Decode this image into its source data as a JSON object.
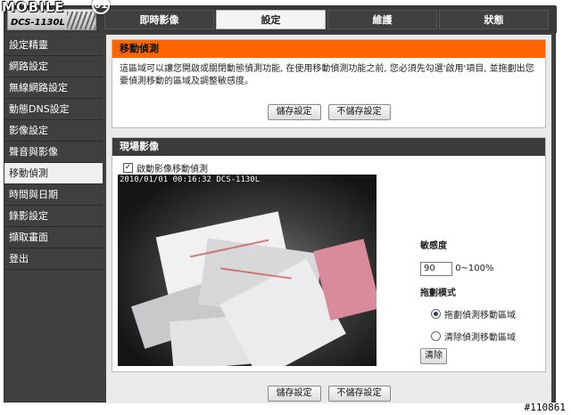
{
  "watermark": {
    "logo": "MOBILE",
    "logo_mark": "01",
    "id": "#110861"
  },
  "device": {
    "model": "DCS-1130L"
  },
  "tabs": [
    {
      "label": "即時影像"
    },
    {
      "label": "設定"
    },
    {
      "label": "維護"
    },
    {
      "label": "狀態"
    }
  ],
  "sidebar": {
    "items": [
      {
        "label": "設定精靈"
      },
      {
        "label": "網路設定"
      },
      {
        "label": "無線網路設定"
      },
      {
        "label": "動態DNS設定"
      },
      {
        "label": "影像設定"
      },
      {
        "label": "聲音與影像"
      },
      {
        "label": "移動偵測"
      },
      {
        "label": "時間與日期"
      },
      {
        "label": "錄影設定"
      },
      {
        "label": "擷取畫面"
      },
      {
        "label": "登出"
      }
    ],
    "active_index": 6
  },
  "motion_detection": {
    "title": "移動偵測",
    "description": "這區域可以讓您開啟或關閉動態偵測功能, 在使用移動偵測功能之前, 您必須先勾選'啟用'項目, 並拖劃出您要偵測移動的區域及調整敏感度。",
    "save_label": "儲存設定",
    "cancel_label": "不儲存設定"
  },
  "live_video": {
    "title": "現場影像",
    "enable_label": "啟動影像移動偵測",
    "enable_checked": true,
    "timestamp": "2010/01/01  00:16:32  DCS-1130L",
    "sensitivity_label": "敏感度",
    "sensitivity_value": "90",
    "sensitivity_range": "0~100%",
    "drag_mode_label": "拖劃模式",
    "drag_options": [
      {
        "label": "拖劃偵測移動區域",
        "selected": true
      },
      {
        "label": "清除偵測移動區域",
        "selected": false
      }
    ],
    "clear_label": "清除"
  },
  "footer": {
    "save_label": "儲存設定",
    "cancel_label": "不儲存設定"
  },
  "colors": {
    "accent": "#ff6600",
    "chrome": "#404040",
    "panel_head": "#3c3c3c"
  }
}
